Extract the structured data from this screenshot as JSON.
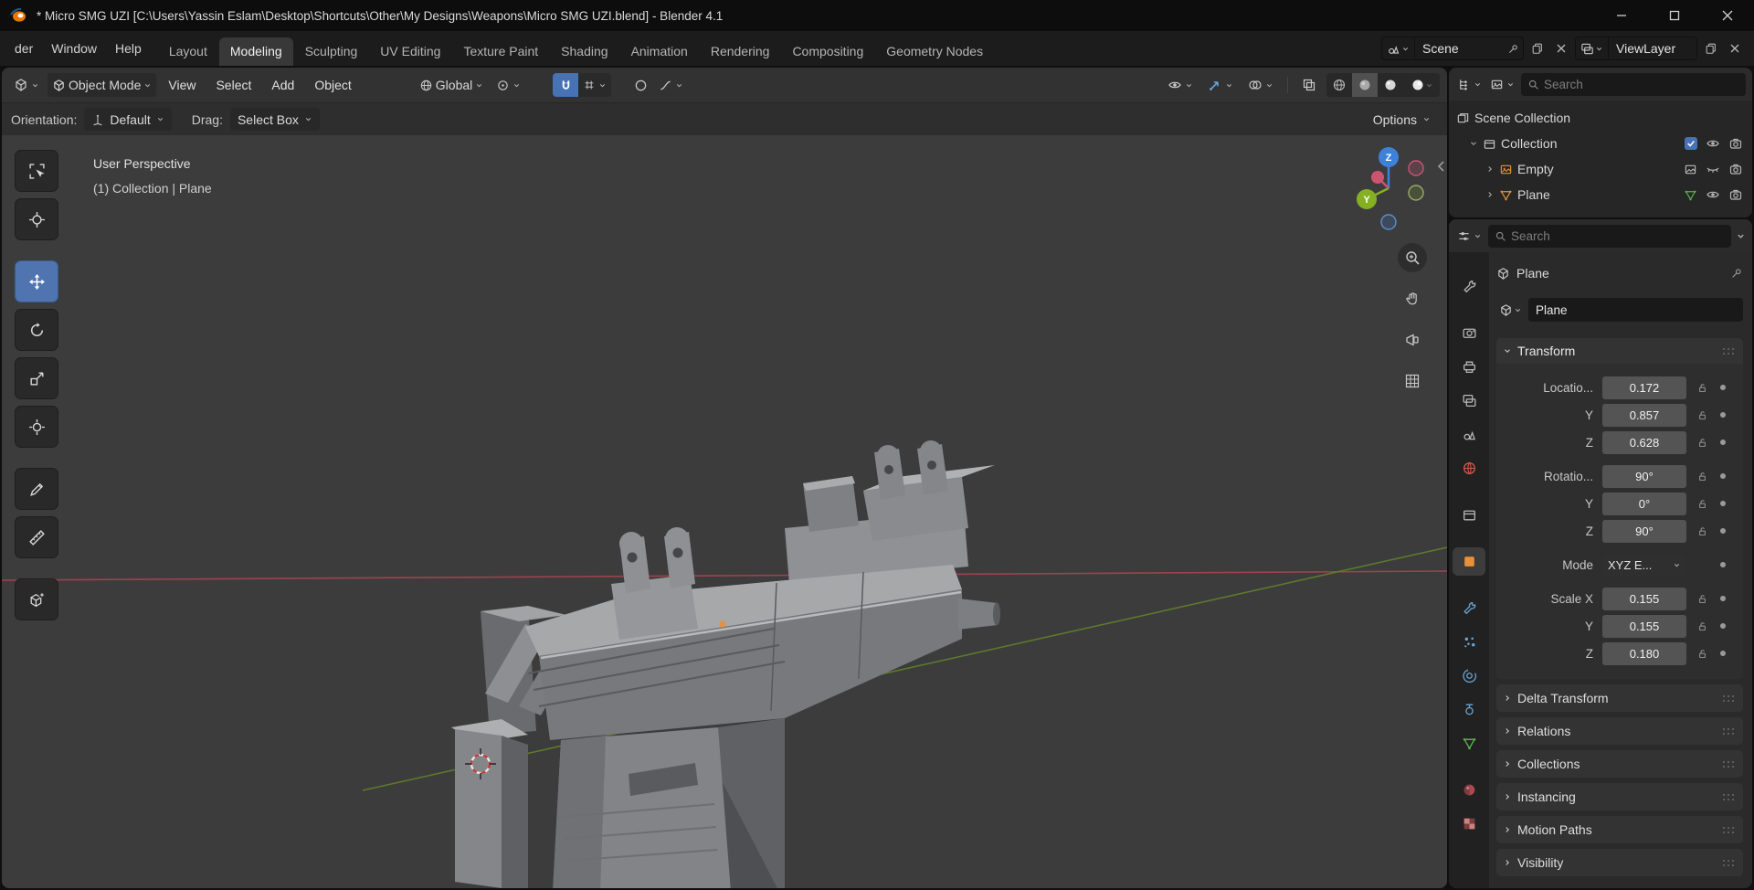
{
  "window": {
    "title": "* Micro SMG UZI [C:\\Users\\Yassin Eslam\\Desktop\\Shortcuts\\Other\\My Designs\\Weapons\\Micro SMG UZI.blend] - Blender 4.1"
  },
  "topbar": {
    "menus": [
      "der",
      "Window",
      "Help"
    ],
    "tabs": [
      "Layout",
      "Modeling",
      "Sculpting",
      "UV Editing",
      "Texture Paint",
      "Shading",
      "Animation",
      "Rendering",
      "Compositing",
      "Geometry Nodes"
    ],
    "active_tab": "Modeling",
    "scene": "Scene",
    "view_layer": "ViewLayer"
  },
  "viewport_header": {
    "mode": "Object Mode",
    "menu_view": "View",
    "menu_select": "Select",
    "menu_add": "Add",
    "menu_object": "Object",
    "orientation": "Global"
  },
  "tool_settings": {
    "orientation_label": "Orientation:",
    "orientation_value": "Default",
    "drag_label": "Drag:",
    "drag_value": "Select Box",
    "options": "Options"
  },
  "viewport": {
    "view_label": "User Perspective",
    "context_label": "(1) Collection | Plane",
    "axis_z": "Z",
    "axis_y": "Y"
  },
  "outliner": {
    "search_placeholder": "Search",
    "root_label": "Scene Collection",
    "rows": [
      {
        "name": "Collection"
      },
      {
        "name": "Empty"
      },
      {
        "name": "Plane"
      }
    ]
  },
  "properties": {
    "search_placeholder": "Search",
    "breadcrumb": "Plane",
    "name_value": "Plane",
    "transform": {
      "title": "Transform",
      "rows": [
        {
          "label": "Locatio...",
          "value": "0.172"
        },
        {
          "label": "Y",
          "value": "0.857"
        },
        {
          "label": "Z",
          "value": "0.628"
        },
        {
          "label": "Rotatio...",
          "value": "90°"
        },
        {
          "label": "Y",
          "value": "0°"
        },
        {
          "label": "Z",
          "value": "90°"
        }
      ],
      "mode_label": "Mode",
      "mode_value": "XYZ E...",
      "scale_rows": [
        {
          "label": "Scale X",
          "value": "0.155"
        },
        {
          "label": "Y",
          "value": "0.155"
        },
        {
          "label": "Z",
          "value": "0.180"
        }
      ]
    },
    "collapsed_panels": [
      "Delta Transform",
      "Relations",
      "Collections",
      "Instancing",
      "Motion Paths",
      "Visibility"
    ]
  },
  "colors": {
    "accent_blue": "#4772b3",
    "object_orange": "#e8913d",
    "mesh_green": "#55b348",
    "axis_x": "#cb5570",
    "axis_y": "#86b024",
    "axis_z": "#3d82d8"
  }
}
